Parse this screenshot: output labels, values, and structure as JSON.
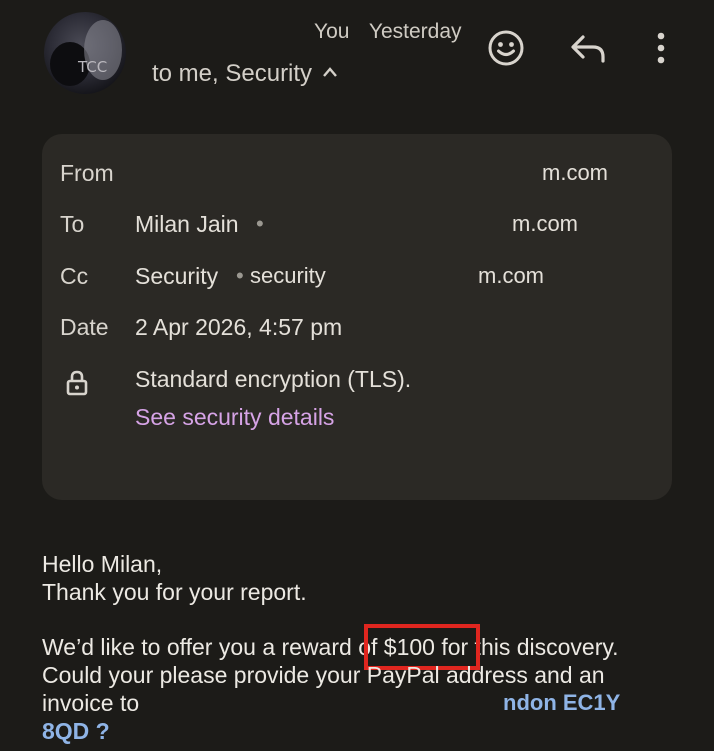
{
  "header": {
    "sender_name": "You",
    "date_label": "Yesterday",
    "recipients_summary": "to me, Security",
    "avatar_text": "TCC"
  },
  "icons": {
    "emoji": "smiley-face-icon",
    "reply": "reply-icon",
    "more": "more-vert-icon",
    "expand": "chevron-up-icon",
    "lock": "lock-icon"
  },
  "details": {
    "from_label": "From",
    "from_value_tail": "m.com",
    "to_label": "To",
    "to_value": "Milan Jain",
    "to_value_tail": "m.com",
    "cc_label": "Cc",
    "cc_value": "Security",
    "cc_value_email": "security",
    "cc_value_tail": "m.com",
    "date_label": "Date",
    "date_value": "2 Apr 2026, 4:57 pm",
    "encryption_text": "Standard encryption (TLS).",
    "security_link": "See security details"
  },
  "message": {
    "greeting": "Hello Milan,",
    "line1": "Thank you for your report.",
    "line2_pre": "We’d like to offer you a reward ",
    "line2_highlight": "of $100 for",
    "line2_post": " this discovery.",
    "line3": "Could your please provide your PayPal address and an",
    "line4_pre": "invoice to",
    "line4_tail": "ndon EC1Y",
    "line5": "8QD ?"
  },
  "colors": {
    "background": "#1c1b18",
    "card": "#2b2925",
    "link": "#d6a3e6",
    "highlight_box": "#e0261f",
    "address_blue": "#8fb4e6"
  }
}
